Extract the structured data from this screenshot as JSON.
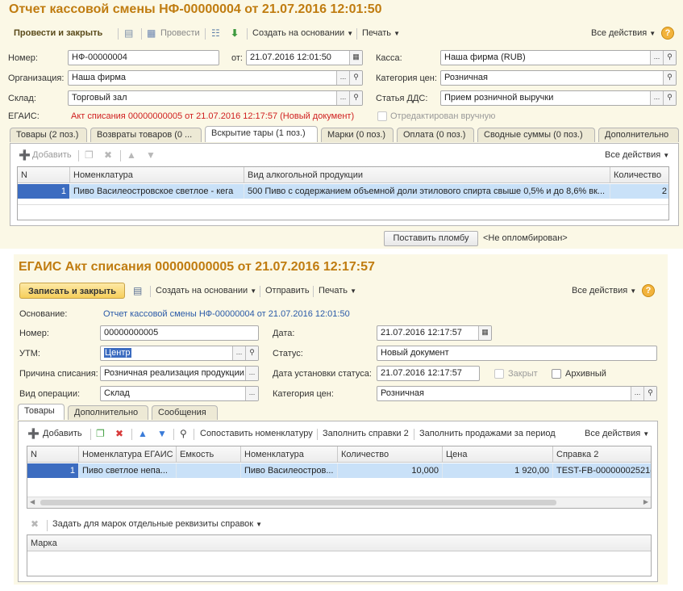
{
  "win1": {
    "title": "Отчет кассовой смены НФ-00000004 от 21.07.2016 12:01:50",
    "toolbar": {
      "post_close": "Провести и закрыть",
      "post": "Провести",
      "create_based": "Создать на основании",
      "print": "Печать",
      "all_actions": "Все действия",
      "help": "?"
    },
    "fields": {
      "number_label": "Номер:",
      "number": "НФ-00000004",
      "date_label": "от:",
      "date": "21.07.2016 12:01:50",
      "cash_label": "Касса:",
      "cash": "Наша фирма (RUB)",
      "org_label": "Организация:",
      "org": "Наша фирма",
      "price_cat_label": "Категория цен:",
      "price_cat": "Розничная",
      "warehouse_label": "Склад:",
      "warehouse": "Торговый зал",
      "dds_label": "Статья ДДС:",
      "dds": "Прием розничной выручки",
      "egais_label": "ЕГАИС:",
      "egais_link": "Акт списания 00000000005 от 21.07.2016 12:17:57 (Новый документ)",
      "edited_manually": "Отредактирован вручную"
    },
    "tabs": [
      "Товары (2 поз.)",
      "Возвраты товаров (0 ...",
      "Вскрытие тары (1 поз.)",
      "Марки (0 поз.)",
      "Оплата (0 поз.)",
      "Сводные суммы (0 поз.)",
      "Дополнительно"
    ],
    "active_tab": 2,
    "table_toolbar": {
      "add": "Добавить",
      "all_actions": "Все действия"
    },
    "table": {
      "headers": [
        "N",
        "Номенклатура",
        "Вид алкогольной продукции",
        "Количество"
      ],
      "rows": [
        [
          "1",
          "Пиво Василеостровское светлое - кега",
          "500 Пиво с содержанием объемной доли этилового спирта свыше 0,5% и до 8,6% вк...",
          "2"
        ]
      ]
    },
    "seal_button": "Поставить пломбу",
    "seal_status": "<Не опломбирован>"
  },
  "win2": {
    "title": "ЕГАИС Акт списания 00000000005 от 21.07.2016 12:17:57",
    "toolbar": {
      "save_close": "Записать и закрыть",
      "create_based": "Создать на основании",
      "send": "Отправить",
      "print": "Печать",
      "all_actions": "Все действия",
      "help": "?"
    },
    "fields": {
      "basis_label": "Основание:",
      "basis": "Отчет кассовой смены НФ-00000004 от 21.07.2016 12:01:50",
      "number_label": "Номер:",
      "number": "00000000005",
      "date_label": "Дата:",
      "date": "21.07.2016 12:17:57",
      "utm_label": "УТМ:",
      "utm": "Центр",
      "status_label": "Статус:",
      "status": "Новый документ",
      "reason_label": "Причина списания:",
      "reason": "Розничная реализация продукции,",
      "status_date_label": "Дата установки статуса:",
      "status_date": "21.07.2016 12:17:57",
      "closed": "Закрыт",
      "archived": "Архивный",
      "op_label": "Вид операции:",
      "op": "Склад",
      "price_cat_label": "Категория цен:",
      "price_cat": "Розничная"
    },
    "tabs": [
      "Товары",
      "Дополнительно",
      "Сообщения"
    ],
    "active_tab": 0,
    "table_toolbar": {
      "add": "Добавить",
      "match": "Сопоставить номенклатуру",
      "fill_ref": "Заполнить справки 2",
      "fill_sales": "Заполнить продажами за период",
      "all_actions": "Все действия"
    },
    "table": {
      "headers": [
        "N",
        "Номенклатура ЕГАИС",
        "Емкость",
        "Номенклатура",
        "Количество",
        "Цена",
        "Справка 2"
      ],
      "rows": [
        [
          "1",
          "Пиво светлое непа...",
          "",
          "Пиво Василеостров...",
          "10,000",
          "1 920,00",
          "TEST-FB-00000002521("
        ]
      ]
    },
    "marks_toolbar": {
      "set_props": "Задать для марок отдельные реквизиты справок"
    },
    "marks_table": {
      "headers": [
        "Марка"
      ]
    }
  }
}
